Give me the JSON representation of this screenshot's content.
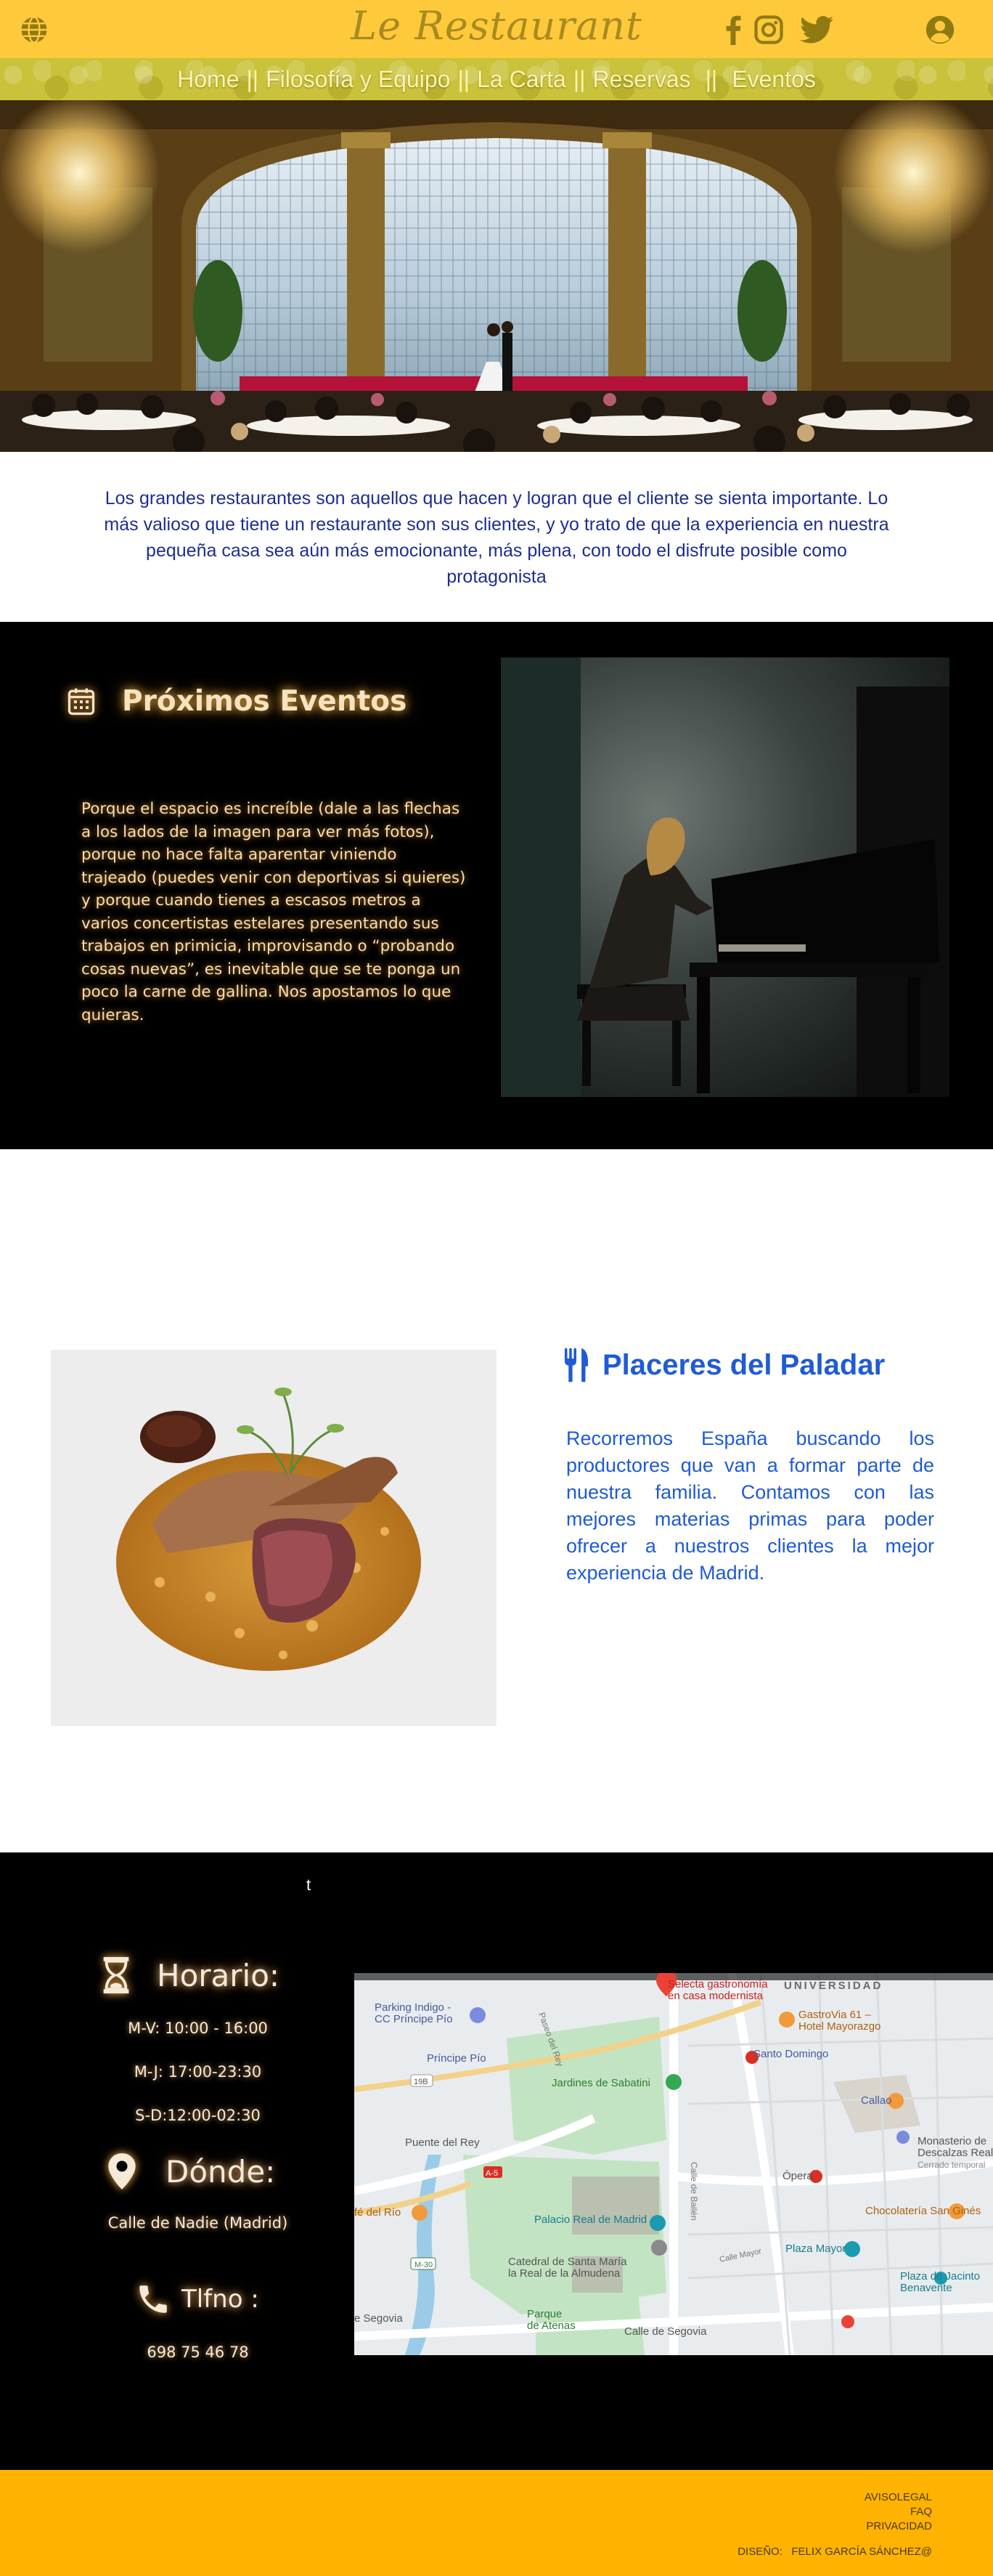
{
  "header": {
    "brand": "Le Restaurant",
    "language_icon": "globe-icon",
    "social_icons": [
      "facebook-icon",
      "instagram-icon",
      "twitter-icon"
    ],
    "account_icon": "user-circle-icon"
  },
  "nav": {
    "items": [
      "Home",
      "Filosofía y Equipo",
      "La Carta",
      "Reservas",
      "Eventos"
    ],
    "separator": "||"
  },
  "intro": {
    "text": "Los grandes restaurantes son aquellos que hacen y logran que el cliente se sienta importante. Lo más valioso que tiene un restaurante son sus clientes, y yo trato de que la experiencia en nuestra pequeña casa sea aún más emocionante, más plena, con todo el disfrute posible como protagonista"
  },
  "events": {
    "icon": "calendar-icon",
    "title": "Próximos Eventos",
    "text": "Porque el espacio es increíble (dale a las flechas a los lados de la imagen para ver más fotos), porque no hace falta aparentar viniendo trajeado (puedes venir con deportivas si quieres) y porque cuando tienes a escasos metros a varios concertistas estelares presentando sus trabajos en primicia, improvisando o “probando cosas nuevas”, es inevitable que se te ponga un poco la carne de gallina. Nos apostamos lo que quieras."
  },
  "flavours": {
    "icon": "cutlery-icon",
    "title": "Placeres del Paladar",
    "text": "Recorremos España buscando los productores que van a formar parte de nuestra familia. Contamos con las mejores materias primas para poder ofrecer a nuestros clientes la mejor experiencia de Madrid."
  },
  "info": {
    "stray_char": "t",
    "schedule": {
      "icon": "hourglass-icon",
      "title": "Horario:",
      "lines": [
        "M-V: 10:00 - 16:00",
        "M-J: 17:00-23:30",
        "S-D:12:00-02:30"
      ]
    },
    "where": {
      "icon": "map-pin-icon",
      "title": "Dónde:",
      "address": "Calle de Nadie (Madrid)"
    },
    "phone": {
      "icon": "phone-icon",
      "title": "Tlfno :",
      "number": "698 75 46 78"
    },
    "map_labels": {
      "selecta": "Selecta gastronomía\nen casa modernista",
      "universidad": "UNIVERSIDAD",
      "parking": "Parking Indigo -\nCC Príncipe Pío",
      "gastrovia": "GastroVia 61 –\nHotel Mayorazgo",
      "principe_pio": "Príncipe Pío",
      "santo_domingo": "Santo Domingo",
      "jardines": "Jardines de Sabatini",
      "callao": "Callao",
      "puente_rey": "Puente del Rey",
      "monasterio": "Monasterio de\nDescalzas Reales",
      "cerrado": "Cerrado temporal",
      "palacio": "Palacio Real de Madrid",
      "opera": "Ópera",
      "chocolateria": "Chocolatería San Ginés",
      "cafe_rio": "fé del Río",
      "catedral": "Catedral de Santa María\nla Real de la Almudena",
      "plaza_mayor": "Plaza Mayor",
      "plaza_jacinto": "Plaza de Jacinto\nBenavente",
      "parque_atenas": "Parque\nde Atenas",
      "segovia_left": "e Segovia",
      "calle_segovia": "Calle de Segovia",
      "calle_bailen": "Calle de Bailén",
      "paseo_rey": "Paseo del Rey",
      "calle_mayor": "Calle Mayor",
      "m30": "M-30",
      "a5": "A-5",
      "r19": "19B"
    }
  },
  "footer": {
    "links": [
      "AVISOLEGAL",
      "FAQ",
      "PRIVACIDAD"
    ],
    "credit_label": "DISEÑO:",
    "credit_name": "FELIX GARCÍA SÁNCHEZ@"
  },
  "colors": {
    "header_bg": "#ffc93c",
    "nav_bg": "#c9c23a",
    "accent_blue": "#1f5bd6",
    "footer_bg": "#ffb300",
    "glow": "#ffb24a"
  }
}
